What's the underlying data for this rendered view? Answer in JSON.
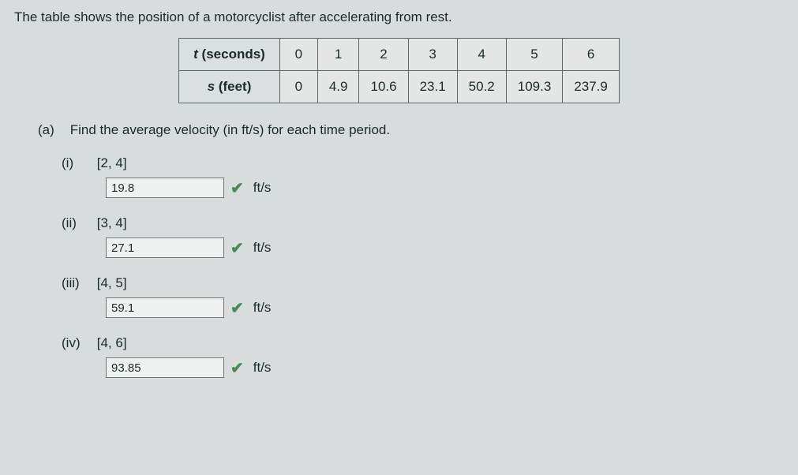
{
  "prompt": "The table shows the position of a motorcyclist after accelerating from rest.",
  "table": {
    "row1_var": "t",
    "row1_unit": "(seconds)",
    "t0": "0",
    "t1": "1",
    "t2": "2",
    "t3": "3",
    "t4": "4",
    "t5": "5",
    "t6": "6",
    "row2_var": "s",
    "row2_unit": "(feet)",
    "s0": "0",
    "s1": "4.9",
    "s2": "10.6",
    "s3": "23.1",
    "s4": "50.2",
    "s5": "109.3",
    "s6": "237.9"
  },
  "part_a": {
    "label": "(a)",
    "text": "Find the average velocity (in ft/s) for each time period."
  },
  "subparts": {
    "i": {
      "label": "(i)",
      "interval": "[2, 4]",
      "answer": "19.8",
      "unit": "ft/s"
    },
    "ii": {
      "label": "(ii)",
      "interval": "[3, 4]",
      "answer": "27.1",
      "unit": "ft/s"
    },
    "iii": {
      "label": "(iii)",
      "interval": "[4, 5]",
      "answer": "59.1",
      "unit": "ft/s"
    },
    "iv": {
      "label": "(iv)",
      "interval": "[4, 6]",
      "answer": "93.85",
      "unit": "ft/s"
    }
  },
  "check_symbol": "✔"
}
